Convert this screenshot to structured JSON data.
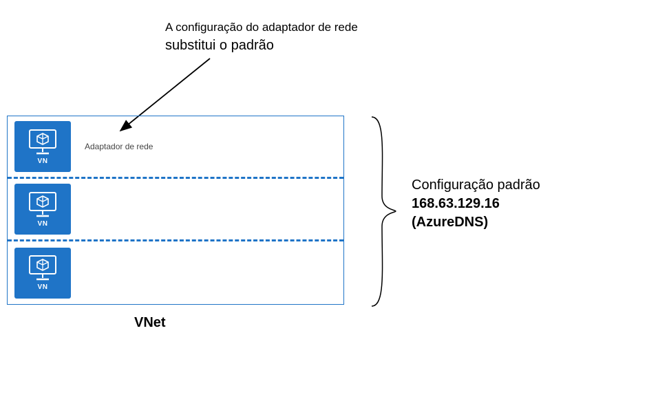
{
  "annotation": {
    "line1": "A configuração do adaptador de rede",
    "line2": "substitui o padrão"
  },
  "vnet": {
    "label": "VNet",
    "vm_badge": "VN",
    "rows": [
      {
        "adapter_label": "Adaptador de rede"
      },
      {
        "adapter_label": ""
      },
      {
        "adapter_label": ""
      }
    ]
  },
  "config": {
    "line1": "Configuração padrão",
    "line2": "168.63.129.16",
    "line3": "(AzureDNS)"
  },
  "icons": {
    "vm": "vm-monitor-cube-icon",
    "arrow": "arrow-pointer-icon",
    "brace": "right-brace-icon"
  }
}
